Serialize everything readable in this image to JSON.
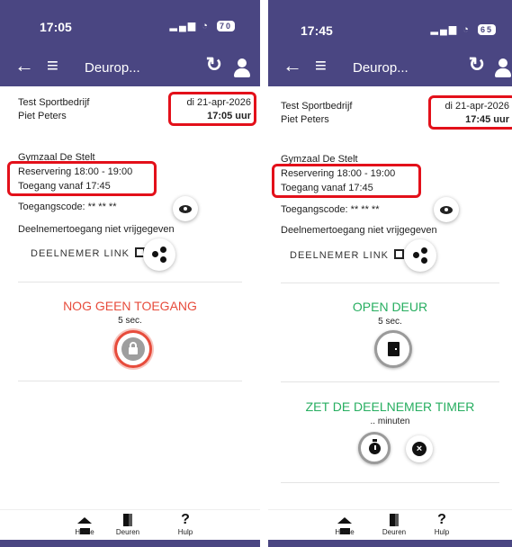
{
  "left": {
    "status": {
      "time": "17:05",
      "signal": "▂▄▆",
      "wifi": "◔",
      "battery": "70"
    },
    "appbar": {
      "back_icon": "←",
      "menu_icon": "≡",
      "title": "Deurop...",
      "refresh_icon": "↻"
    },
    "info": {
      "company": "Test Sportbedrijf",
      "person": "Piet Peters",
      "date": "di 21-apr-2026",
      "time": "17:05 uur",
      "location": "Gymzaal De Stelt",
      "reservation": "Reservering 18:00 - 19:00",
      "access_from": "Toegang vanaf 17:45",
      "access_code": "Toegangscode: ** ** **",
      "participant_access": "Deelnemertoegang niet vrijgegeven",
      "participant_link": "DEELNEMER LINK"
    },
    "door": {
      "status": "NOG GEEN TOEGANG",
      "seconds": "5 sec.",
      "status_color": "#e74c3c"
    }
  },
  "right": {
    "status": {
      "time": "17:45",
      "signal": "▂▄▆",
      "wifi": "◔",
      "battery": "65"
    },
    "appbar": {
      "back_icon": "←",
      "menu_icon": "≡",
      "title": "Deurop...",
      "refresh_icon": "↻"
    },
    "info": {
      "company": "Test Sportbedrijf",
      "person": "Piet Peters",
      "date": "di 21-apr-2026",
      "time": "17:45 uur",
      "location": "Gymzaal De Stelt",
      "reservation": "Reservering 18:00 - 19:00",
      "access_from": "Toegang vanaf 17:45",
      "access_code": "Toegangscode: ** ** **",
      "participant_access": "Deelnemertoegang niet vrijgegeven",
      "participant_link": "DEELNEMER LINK"
    },
    "door": {
      "status": "OPEN DEUR",
      "seconds": "5 sec.",
      "status_color": "#27ae60"
    },
    "timer": {
      "title": "ZET DE DEELNEMER TIMER",
      "minutes": ".. minuten",
      "title_color": "#27ae60"
    }
  },
  "nav": {
    "home": "Home",
    "doors": "Deuren",
    "help": "Hulp",
    "help_icon": "?"
  },
  "colors": {
    "brand": "#4a4682",
    "highlight": "#e3101a"
  }
}
